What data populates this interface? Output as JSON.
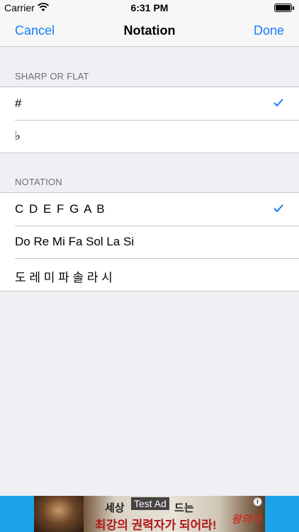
{
  "status_bar": {
    "carrier": "Carrier",
    "time": "6:31 PM"
  },
  "nav": {
    "cancel_label": "Cancel",
    "title": "Notation",
    "done_label": "Done"
  },
  "sections": [
    {
      "header": "SHARP OR FLAT",
      "items": [
        {
          "label": "#",
          "selected": true
        },
        {
          "label": "♭",
          "selected": false
        }
      ]
    },
    {
      "header": "NOTATION",
      "items": [
        {
          "label": "C D E F G A B",
          "selected": true
        },
        {
          "label": "Do Re Mi Fa Sol La Si",
          "selected": false
        },
        {
          "label": "도 레 미 파 솔 라 시",
          "selected": false
        }
      ]
    }
  ],
  "ad": {
    "test_label": "Test Ad",
    "line1_a": "세상",
    "line1_b": "드는",
    "line2": "최강의 권력자가 되어라!",
    "logo_text": "왕의자",
    "info_icon": "i"
  },
  "colors": {
    "accent": "#157efb",
    "background": "#efeff4",
    "ad_background": "#1aa3e8"
  }
}
